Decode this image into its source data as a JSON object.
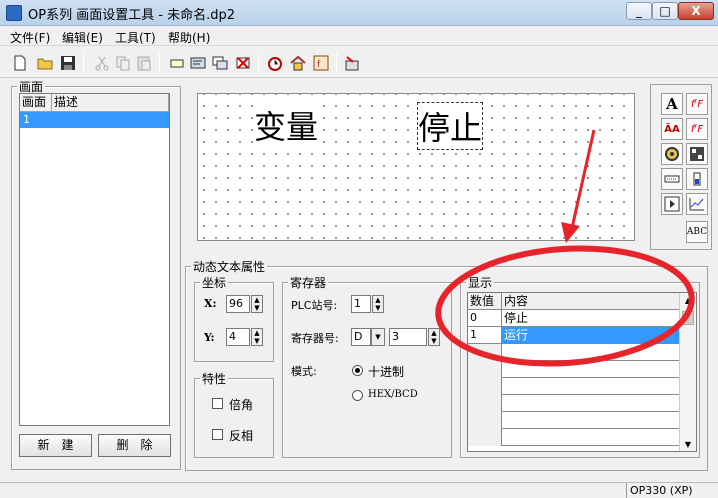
{
  "window": {
    "title": "OP系列 画面设置工具 - 未命名.dp2",
    "minimize": "_",
    "maximize": "□",
    "close": "X"
  },
  "menu": [
    "文件(F)",
    "编辑(E)",
    "工具(T)",
    "帮助(H)"
  ],
  "screen_panel": {
    "label": "画面",
    "columns": [
      "画面",
      "描述"
    ],
    "rows": [
      {
        "id": "1",
        "desc": ""
      }
    ],
    "new_button": "新　建",
    "delete_button": "删　除"
  },
  "canvas": {
    "variable_text": "变量",
    "dynamic_text": "停止"
  },
  "palette": {
    "text_tool": "A",
    "abc_tool": "ABC"
  },
  "props": {
    "label": "动态文本属性",
    "coords": {
      "label": "坐标",
      "x_label": "X:",
      "x_value": "96",
      "y_label": "Y:",
      "y_value": "4"
    },
    "traits": {
      "label": "特性",
      "double_label": "倍角",
      "inverse_label": "反相"
    },
    "register": {
      "label": "寄存器",
      "plc_label": "PLC站号:",
      "plc_value": "1",
      "reg_label": "寄存器号:",
      "reg_type": "D",
      "reg_value": "3",
      "mode_label": "模式:",
      "mode_decimal": "十进制",
      "mode_hex": "HEX/BCD"
    },
    "display": {
      "label": "显示",
      "columns": [
        "数值",
        "内容"
      ],
      "rows": [
        {
          "value": "0",
          "content": "停止"
        },
        {
          "value": "1",
          "content": "运行"
        }
      ]
    }
  },
  "status": {
    "model": "OP330 (XP)"
  },
  "colors": {
    "selection": "#3399ff",
    "annotation": "#e8242b"
  }
}
